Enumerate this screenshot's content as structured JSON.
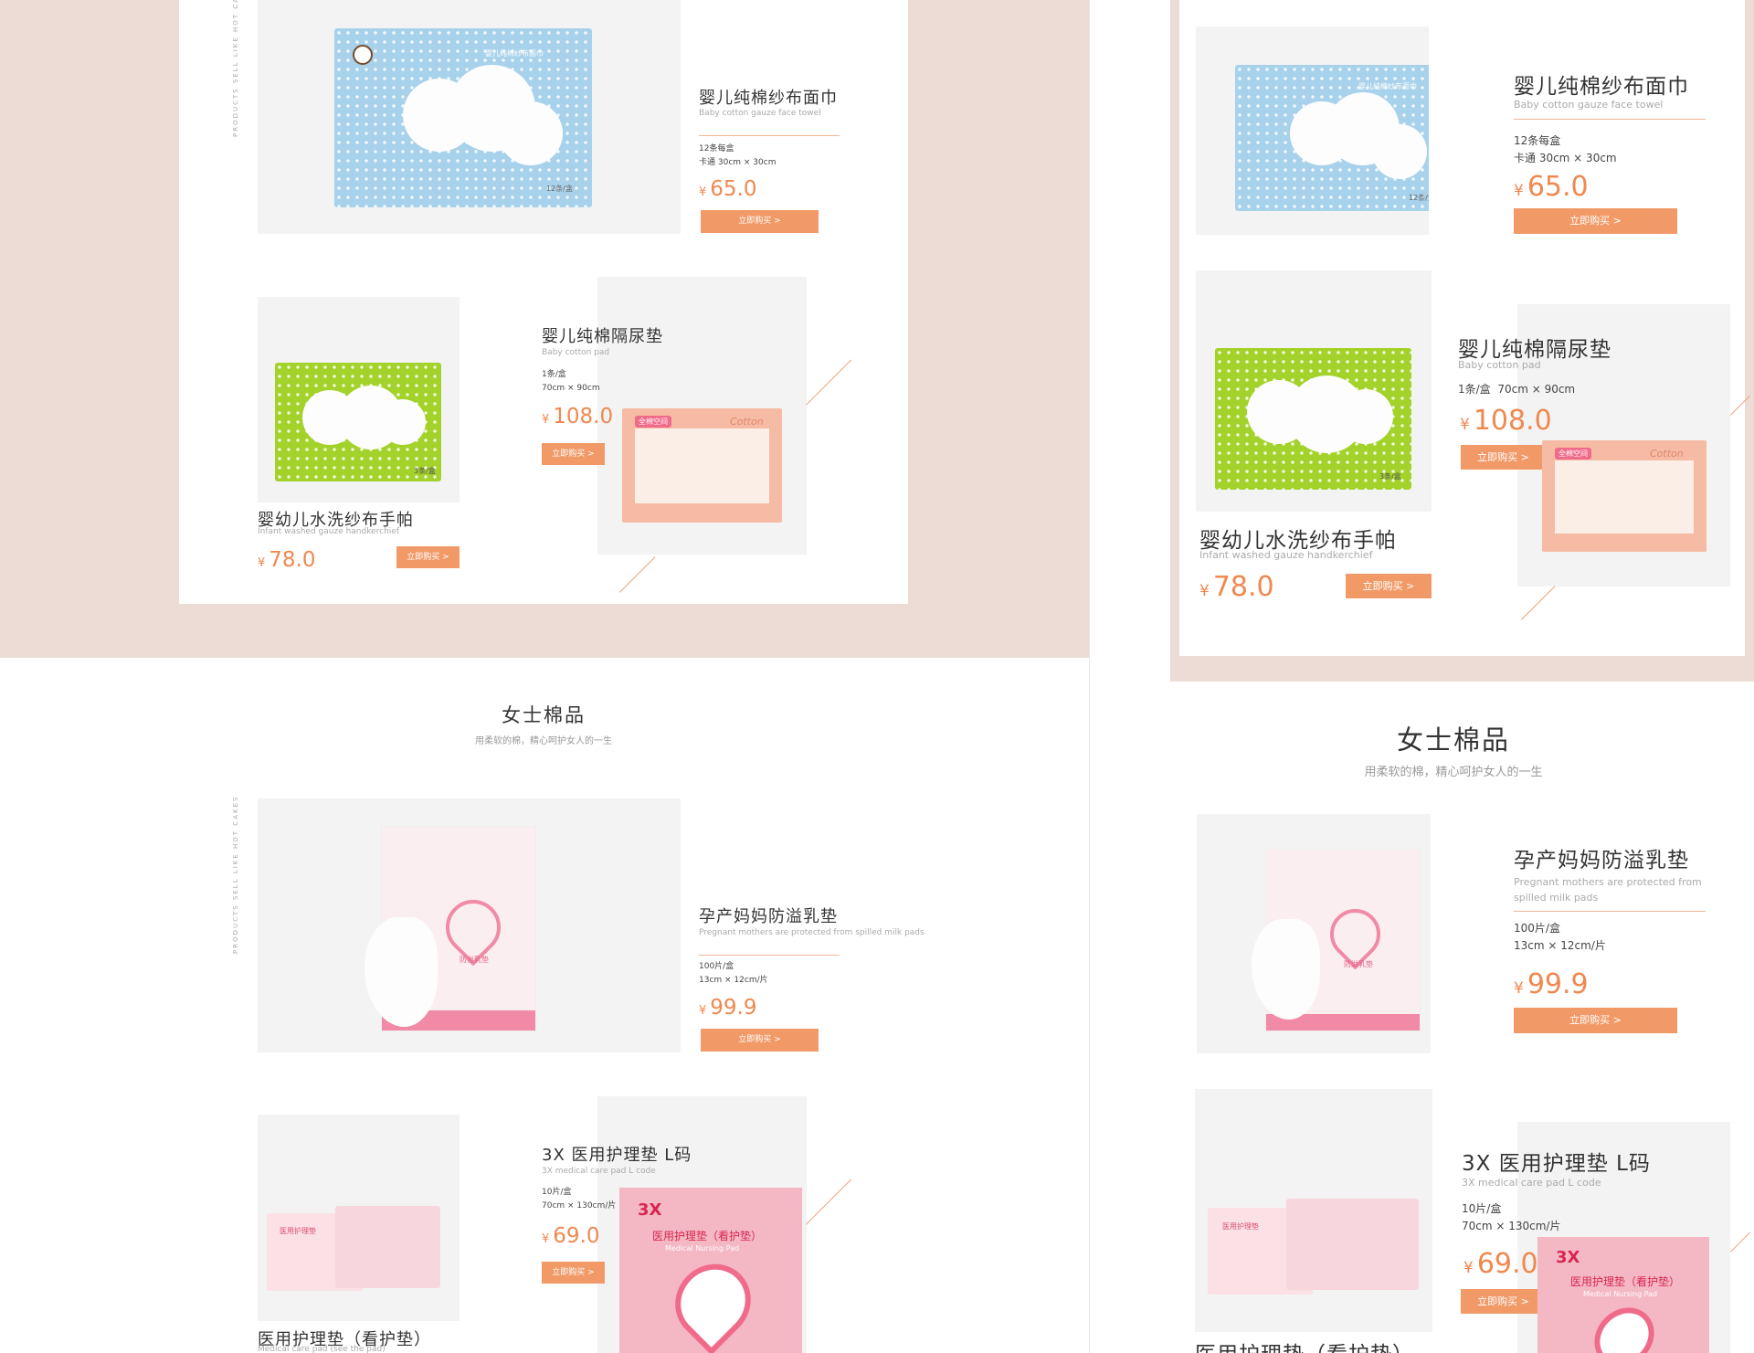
{
  "side_text": "PRODUCTS SELL LIKE HOT CAKES",
  "section_women": {
    "title": "女士棉品",
    "subtitle": "用柔软的棉，精心呵护女人的一生"
  },
  "products": {
    "face_towel": {
      "name": "婴儿纯棉纱布面巾",
      "sub": "Baby cotton gauze face towel",
      "spec1": "12条每盒",
      "spec2": "卡通 30cm × 30cm",
      "currency": "¥",
      "price": "65.0",
      "buy": "立即购买 >",
      "box_label": "婴儿纯棉纱布面巾",
      "box_count": "12条/盒"
    },
    "handkerchief": {
      "name": "婴幼儿水洗纱布手帕",
      "sub": "Infant washed gauze handkerchief",
      "currency": "¥",
      "price": "78.0",
      "buy": "立即购买 >",
      "box_count": "3条/盒"
    },
    "cotton_pad": {
      "name": "婴儿纯棉隔尿垫",
      "sub": "Baby cotton pad",
      "spec1": "1条/盒",
      "spec2": "70cm × 90cm",
      "currency": "¥",
      "price": "108.0",
      "buy": "立即购买 >",
      "brand": "全棉空间",
      "script": "Cotton"
    },
    "milk_pad": {
      "name": "孕产妈妈防溢乳垫",
      "sub": "Pregnant mothers are protected from spilled milk pads",
      "spec1": "100片/盒",
      "spec2": "13cm × 12cm/片",
      "currency": "¥",
      "price": "99.9",
      "buy": "立即购买 >",
      "box_label": "防溢乳垫"
    },
    "care_pad_l": {
      "name": "3X 医用护理垫 L码",
      "sub": "3X medical care pad L code",
      "spec1": "10片/盒",
      "spec2": "70cm × 130cm/片",
      "currency": "¥",
      "price": "69.0",
      "buy": "立即购买 >",
      "box_brand": "3X",
      "box_title": "医用护理垫（看护垫）",
      "box_en": "Medical Nursing Pad"
    },
    "care_pad": {
      "name": "医用护理垫（看护垫）",
      "sub": "Medical care pad (see the pad)",
      "box_label": "医用护理垫"
    }
  },
  "colors": {
    "accent": "#f19a68",
    "price": "#f0884f",
    "pink_bg": "#eddcd5",
    "blue_box": "#a8d2eb",
    "green_box": "#a3d22a",
    "peach_box": "#f5bba4",
    "pink_box": "#f4b7c4"
  }
}
